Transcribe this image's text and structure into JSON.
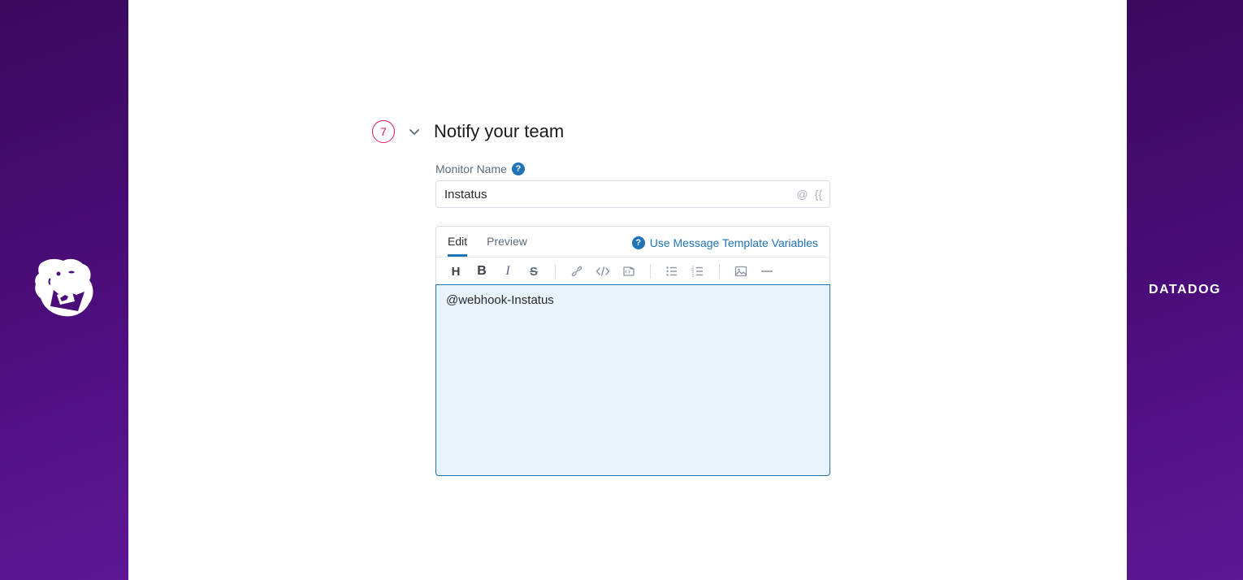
{
  "step": {
    "number": "7",
    "title": "Notify your team"
  },
  "monitorName": {
    "label": "Monitor Name",
    "value": "Instatus",
    "suffixAt": "@",
    "suffixBraces": "{{"
  },
  "tabs": {
    "edit": "Edit",
    "preview": "Preview",
    "templateLink": "Use Message Template Variables"
  },
  "message": {
    "value": "@webhook-Instatus"
  },
  "brand": {
    "wordmark": "DATADOG"
  }
}
